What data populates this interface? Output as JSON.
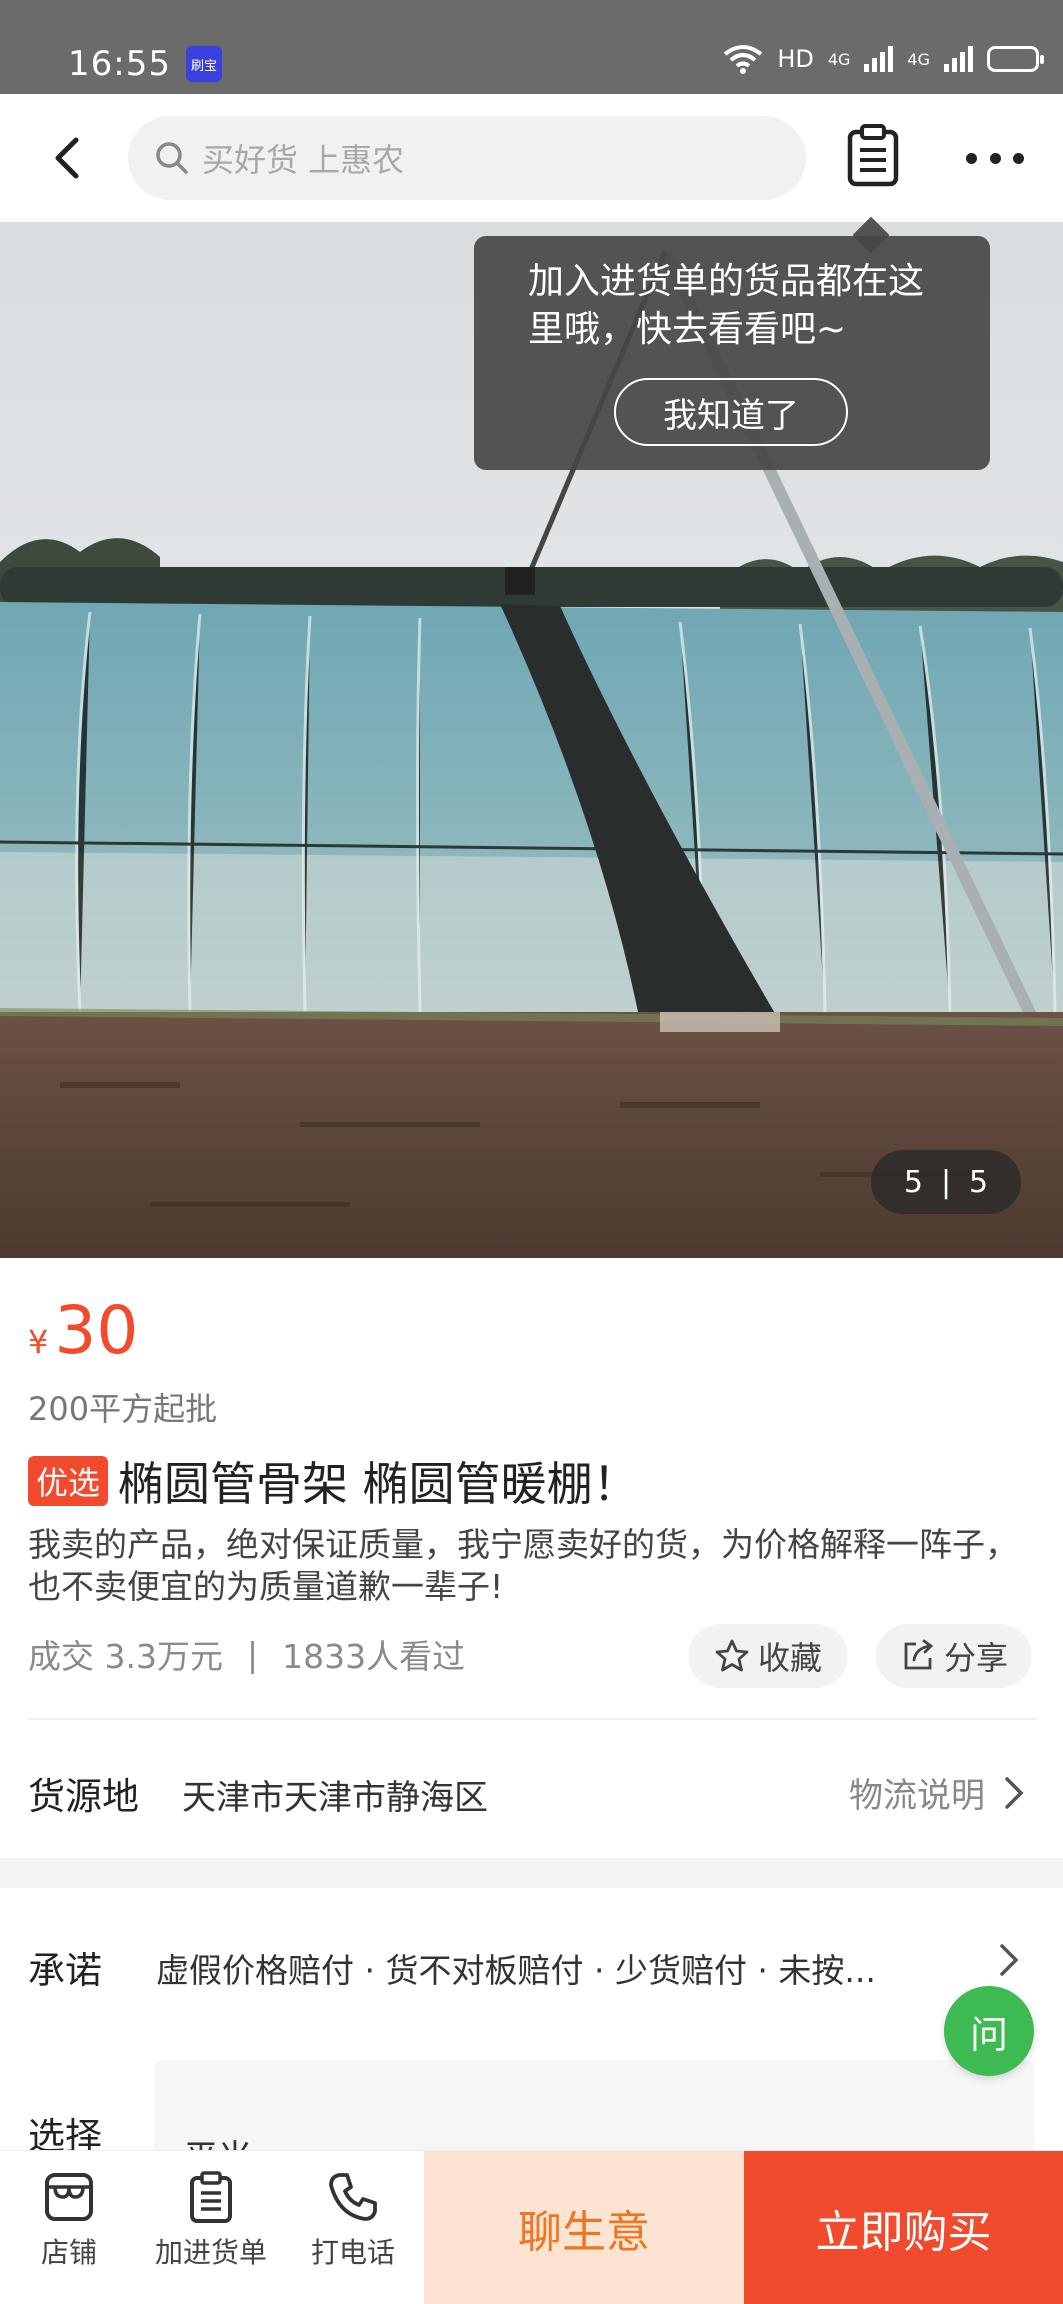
{
  "status_bar": {
    "time": "16:55",
    "app_icon_text": "刷宝",
    "network": "HD",
    "signal1": "4G",
    "signal2": "4G"
  },
  "nav": {
    "search_placeholder": "买好货 上惠农"
  },
  "tooltip": {
    "text": "加入进货单的货品都在这里哦，快去看看吧~",
    "button": "我知道了"
  },
  "gallery": {
    "current": "5",
    "divider": "|",
    "total": "5"
  },
  "product": {
    "currency": "¥",
    "price": "30",
    "moq": "200平方起批",
    "badge": "优选",
    "title": "椭圆管骨架 椭圆管暖棚！",
    "description": "我卖的产品，绝对保证质量，我宁愿卖好的货，为价格解释一阵子，也不卖便宜的为质量道歉一辈子!",
    "sales": "成交 3.3万元",
    "stats_sep": "|",
    "views": "1833人看过",
    "favorite_label": "收藏",
    "share_label": "分享"
  },
  "origin": {
    "label": "货源地",
    "value": "天津市天津市静海区",
    "logistics_label": "物流说明"
  },
  "promise": {
    "label": "承诺",
    "value": "虚假价格赔付 · 货不对板赔付 · 少货赔付 · 未按..."
  },
  "select": {
    "label": "选择",
    "option": "平米"
  },
  "ask_button": "问",
  "bottom_bar": {
    "shop": "店铺",
    "add_to_list": "加进货单",
    "call": "打电话",
    "chat": "聊生意",
    "buy_now": "立即购买"
  },
  "colors": {
    "accent": "#f24a2c",
    "chat_bg": "#fde3d2",
    "chat_text": "#f07520",
    "ask_green": "#3dbb52"
  }
}
